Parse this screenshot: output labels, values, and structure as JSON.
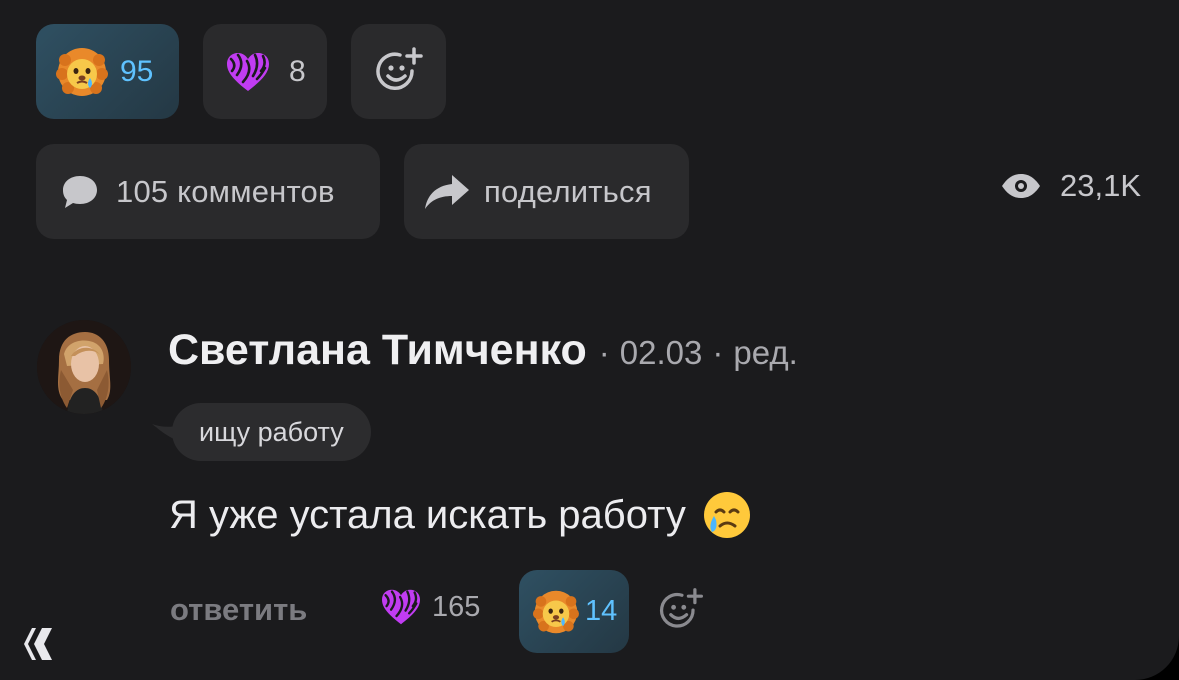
{
  "post_reactions": [
    {
      "emoji": "lion-crying-emoji",
      "count": "95",
      "active": true
    },
    {
      "emoji": "zebra-heart-emoji",
      "count": "8",
      "active": false
    }
  ],
  "actions": {
    "comments_label": "105 комментов",
    "share_label": "поделиться",
    "views": "23,1K"
  },
  "comment": {
    "author": "Светлана Тимченко",
    "separator1": "·",
    "date": "02.03",
    "separator2": "·",
    "edited": "ред.",
    "tag": "ищу работу",
    "text": "Я уже устала искать работу",
    "reply_label": "ответить",
    "reactions": [
      {
        "emoji": "zebra-heart-emoji",
        "count": "165",
        "active": false
      },
      {
        "emoji": "lion-crying-emoji",
        "count": "14",
        "active": true
      }
    ]
  },
  "colors": {
    "background": "#1b1b1d",
    "chip": "#2a2a2c",
    "active_count": "#5fc2ff",
    "text_primary": "#efeff1",
    "text_secondary": "#a9a9ae"
  }
}
